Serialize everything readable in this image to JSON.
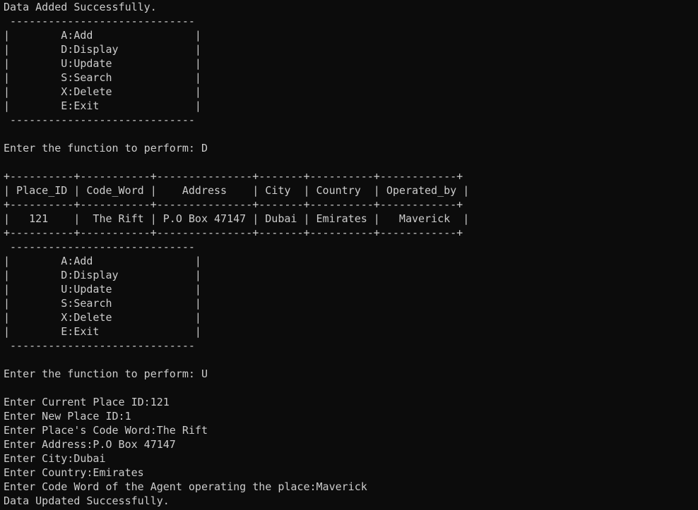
{
  "terminal": {
    "lines": [
      "Data Added Successfully.",
      " -----------------------------",
      "|        A:Add                |",
      "|        D:Display            |",
      "|        U:Update             |",
      "|        S:Search             |",
      "|        X:Delete             |",
      "|        E:Exit               |",
      " -----------------------------",
      "",
      "Enter the function to perform: D",
      "",
      "+----------+-----------+---------------+-------+----------+------------+",
      "| Place_ID | Code_Word |    Address    | City  | Country  | Operated_by |",
      "+----------+-----------+---------------+-------+----------+------------+",
      "|   121    |  The Rift | P.O Box 47147 | Dubai | Emirates |   Maverick  |",
      "+----------+-----------+---------------+-------+----------+------------+",
      " -----------------------------",
      "|        A:Add                |",
      "|        D:Display            |",
      "|        U:Update             |",
      "|        S:Search             |",
      "|        X:Delete             |",
      "|        E:Exit               |",
      " -----------------------------",
      "",
      "Enter the function to perform: U",
      "",
      "Enter Current Place ID:121",
      "Enter New Place ID:1",
      "Enter Place's Code Word:The Rift",
      "Enter Address:P.O Box 47147",
      "Enter City:Dubai",
      "Enter Country:Emirates",
      "Enter Code Word of the Agent operating the place:Maverick",
      "Data Updated Successfully."
    ]
  },
  "colors": {
    "background": "#0c0c0c",
    "foreground": "#cccccc"
  }
}
